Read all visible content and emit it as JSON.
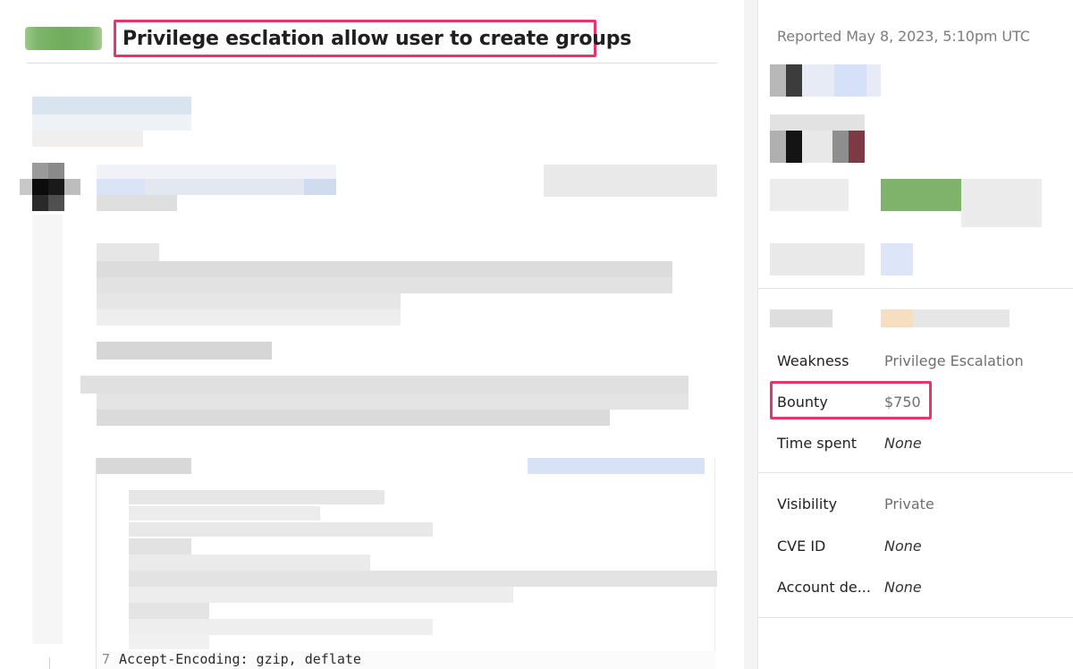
{
  "report": {
    "title": "Privilege esclation allow user to create groups"
  },
  "code": {
    "line_number": "7",
    "line_text": "Accept-Encoding: gzip, deflate"
  },
  "sidebar": {
    "quote_icon": "quote-icon",
    "reported": "Reported May 8, 2023, 5:10pm UTC",
    "details": [
      {
        "key": "Weakness",
        "value": "Privilege Escalation"
      },
      {
        "key": "Bounty",
        "value": "$750"
      },
      {
        "key": "Time spent",
        "value": "None"
      }
    ],
    "meta": [
      {
        "key": "Visibility",
        "value": "Private"
      },
      {
        "key": "CVE ID",
        "value": "None"
      },
      {
        "key": "Account de...",
        "value": "None"
      }
    ]
  },
  "colors": {
    "highlight": "#e8336d",
    "status_chip": "#7eb66c"
  }
}
